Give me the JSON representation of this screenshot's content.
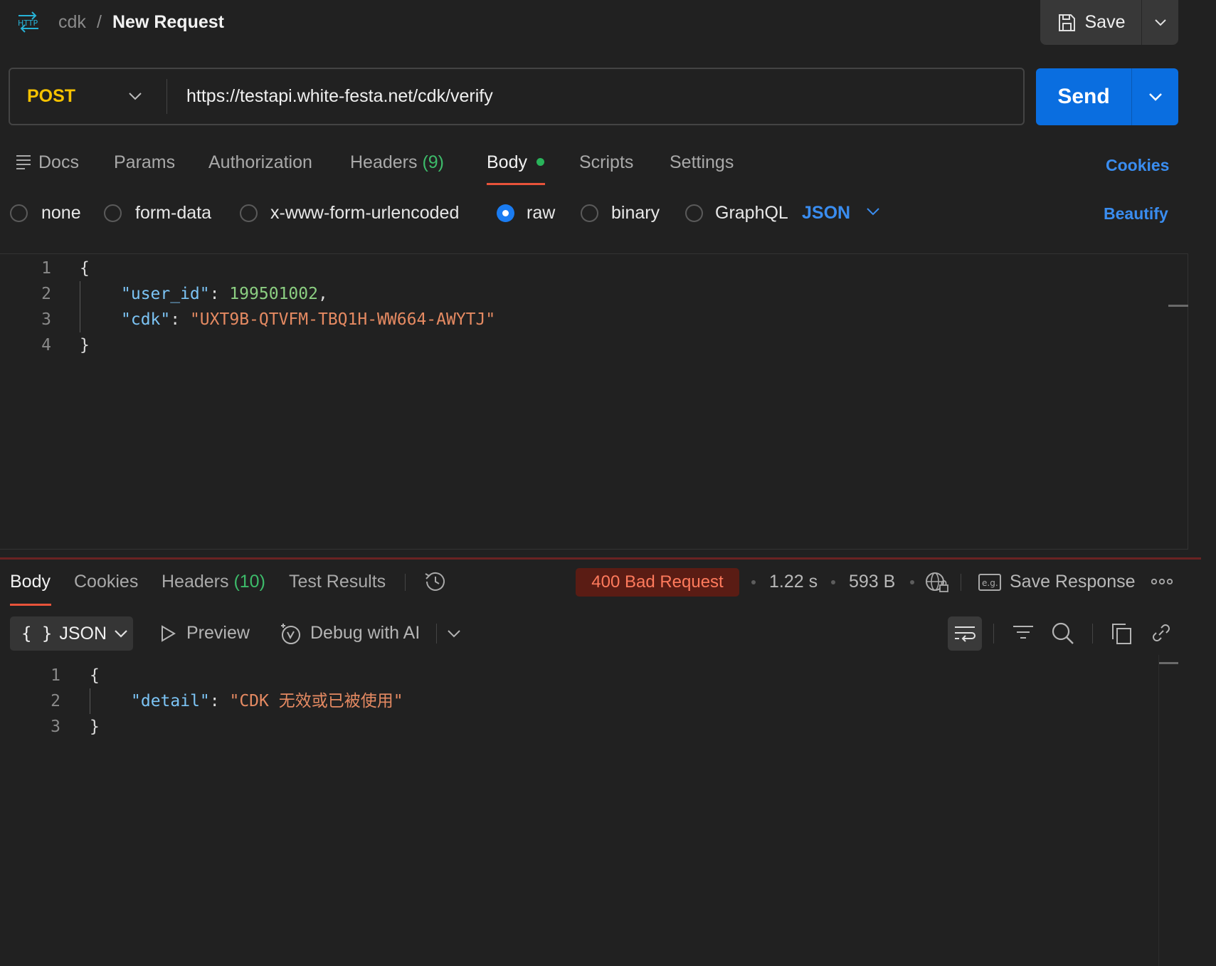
{
  "breadcrumb": {
    "logo_text": "HTTP",
    "collection": "cdk",
    "separator": "/",
    "title": "New Request"
  },
  "toolbar": {
    "save_label": "Save"
  },
  "request": {
    "method": "POST",
    "url": "https://testapi.white-festa.net/cdk/verify",
    "send_label": "Send"
  },
  "request_tabs": {
    "docs": "Docs",
    "params": "Params",
    "authorization": "Authorization",
    "headers": "Headers",
    "headers_count": "(9)",
    "body": "Body",
    "scripts": "Scripts",
    "settings": "Settings",
    "cookies": "Cookies"
  },
  "body_types": {
    "none": "none",
    "form_data": "form-data",
    "urlencoded": "x-www-form-urlencoded",
    "raw": "raw",
    "binary": "binary",
    "graphql": "GraphQL",
    "selected": "raw",
    "language": "JSON",
    "beautify": "Beautify"
  },
  "request_body": {
    "line_numbers": [
      "1",
      "2",
      "3",
      "4"
    ],
    "open_brace": "{",
    "close_brace": "}",
    "user_id_key": "\"user_id\"",
    "user_id_value": "199501002",
    "cdk_key": "\"cdk\"",
    "cdk_value": "\"UXT9B-QTVFM-TBQ1H-WW664-AWYTJ\"",
    "colon": ": ",
    "comma": ","
  },
  "response_tabs": {
    "body": "Body",
    "cookies": "Cookies",
    "headers": "Headers",
    "headers_count": "(10)",
    "test_results": "Test Results"
  },
  "response_meta": {
    "status": "400 Bad Request",
    "time": "1.22 s",
    "size": "593 B",
    "save_response": "Save Response"
  },
  "response_toolbar": {
    "format": "JSON",
    "preview": "Preview",
    "debug_ai": "Debug with AI"
  },
  "response_body": {
    "line_numbers": [
      "1",
      "2",
      "3"
    ],
    "open_brace": "{",
    "close_brace": "}",
    "detail_key": "\"detail\"",
    "detail_value": "\"CDK 无效或已被使用\"",
    "colon": ": "
  },
  "colors": {
    "background": "#212121",
    "method": "#f5c200",
    "send": "#0a6ee0",
    "link": "#3a8df0",
    "status_bg": "#5a1c14",
    "status_text": "#ff7a5c",
    "json_key": "#7cc4f5",
    "json_string": "#e58a62",
    "json_number": "#8ccf82"
  }
}
